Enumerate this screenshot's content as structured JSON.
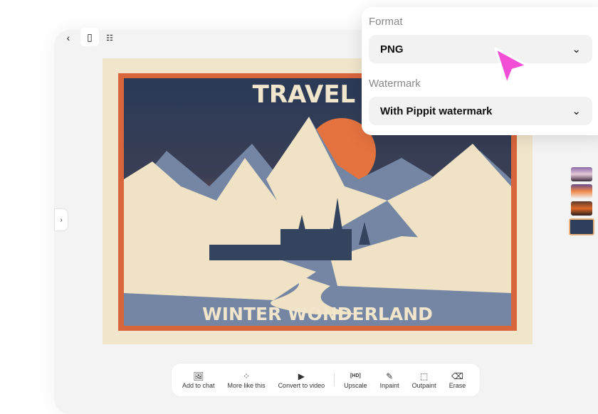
{
  "toolbar": {
    "back": "back",
    "view_single": "single-view",
    "view_grid": "grid-view"
  },
  "poster": {
    "title_top": "TRAVEL A",
    "title_bottom": "WINTER WONDERLAND"
  },
  "actions": [
    {
      "label": "Add to chat",
      "icon": "image-add-icon"
    },
    {
      "label": "More like this",
      "icon": "variations-icon"
    },
    {
      "label": "Convert to video",
      "icon": "play-icon"
    },
    {
      "label": "Upscale",
      "icon": "hd-icon"
    },
    {
      "label": "Inpaint",
      "icon": "brush-icon"
    },
    {
      "label": "Outpaint",
      "icon": "expand-icon"
    },
    {
      "label": "Erase",
      "icon": "eraser-icon"
    }
  ],
  "export": {
    "format_label": "Format",
    "format_value": "PNG",
    "watermark_label": "Watermark",
    "watermark_value": "With Pippit watermark"
  },
  "colors": {
    "accent": "#f24fd6",
    "navy": "#2e3e5c",
    "cream": "#f2e6cc",
    "orange": "#d9653c"
  }
}
